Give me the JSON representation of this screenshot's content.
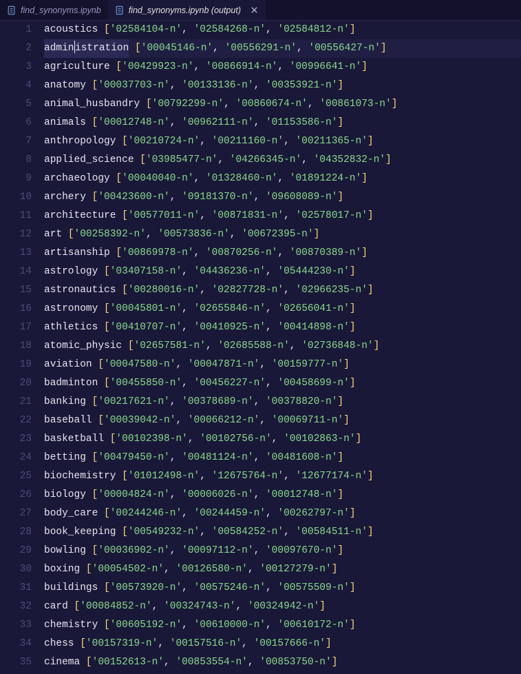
{
  "tabs": [
    {
      "label": "find_synonyms.ipynb",
      "active": false,
      "closable": false
    },
    {
      "label": "find_synonyms.ipynb (output)",
      "active": true,
      "closable": true
    }
  ],
  "lines": [
    {
      "n": 1,
      "word": "acoustics",
      "ids": [
        "02584104-n",
        "02584268-n",
        "02584812-n"
      ]
    },
    {
      "n": 2,
      "word": "administration",
      "ids": [
        "00045146-n",
        "00556291-n",
        "00556427-n"
      ],
      "selected": true,
      "cursor": 5
    },
    {
      "n": 3,
      "word": "agriculture",
      "ids": [
        "00429923-n",
        "00866914-n",
        "00996641-n"
      ]
    },
    {
      "n": 4,
      "word": "anatomy",
      "ids": [
        "00037703-n",
        "00133136-n",
        "00353921-n"
      ]
    },
    {
      "n": 5,
      "word": "animal_husbandry",
      "ids": [
        "00792299-n",
        "00860674-n",
        "00861073-n"
      ]
    },
    {
      "n": 6,
      "word": "animals",
      "ids": [
        "00012748-n",
        "00962111-n",
        "01153586-n"
      ]
    },
    {
      "n": 7,
      "word": "anthropology",
      "ids": [
        "00210724-n",
        "00211160-n",
        "00211365-n"
      ]
    },
    {
      "n": 8,
      "word": "applied_science",
      "ids": [
        "03985477-n",
        "04266345-n",
        "04352832-n"
      ]
    },
    {
      "n": 9,
      "word": "archaeology",
      "ids": [
        "00040040-n",
        "01328460-n",
        "01891224-n"
      ]
    },
    {
      "n": 10,
      "word": "archery",
      "ids": [
        "00423600-n",
        "09181370-n",
        "09608089-n"
      ]
    },
    {
      "n": 11,
      "word": "architecture",
      "ids": [
        "00577011-n",
        "00871831-n",
        "02578017-n"
      ]
    },
    {
      "n": 12,
      "word": "art",
      "ids": [
        "00258392-n",
        "00573836-n",
        "00672395-n"
      ]
    },
    {
      "n": 13,
      "word": "artisanship",
      "ids": [
        "00869978-n",
        "00870256-n",
        "00870389-n"
      ]
    },
    {
      "n": 14,
      "word": "astrology",
      "ids": [
        "03407158-n",
        "04436236-n",
        "05444230-n"
      ]
    },
    {
      "n": 15,
      "word": "astronautics",
      "ids": [
        "00280016-n",
        "02827728-n",
        "02966235-n"
      ]
    },
    {
      "n": 16,
      "word": "astronomy",
      "ids": [
        "00045801-n",
        "02655846-n",
        "02656041-n"
      ]
    },
    {
      "n": 17,
      "word": "athletics",
      "ids": [
        "00410707-n",
        "00410925-n",
        "00414898-n"
      ]
    },
    {
      "n": 18,
      "word": "atomic_physic",
      "ids": [
        "02657581-n",
        "02685588-n",
        "02736848-n"
      ]
    },
    {
      "n": 19,
      "word": "aviation",
      "ids": [
        "00047580-n",
        "00047871-n",
        "00159777-n"
      ]
    },
    {
      "n": 20,
      "word": "badminton",
      "ids": [
        "00455850-n",
        "00456227-n",
        "00458699-n"
      ]
    },
    {
      "n": 21,
      "word": "banking",
      "ids": [
        "00217621-n",
        "00378689-n",
        "00378820-n"
      ]
    },
    {
      "n": 22,
      "word": "baseball",
      "ids": [
        "00039042-n",
        "00066212-n",
        "00069711-n"
      ]
    },
    {
      "n": 23,
      "word": "basketball",
      "ids": [
        "00102398-n",
        "00102756-n",
        "00102863-n"
      ]
    },
    {
      "n": 24,
      "word": "betting",
      "ids": [
        "00479450-n",
        "00481124-n",
        "00481608-n"
      ]
    },
    {
      "n": 25,
      "word": "biochemistry",
      "ids": [
        "01012498-n",
        "12675764-n",
        "12677174-n"
      ]
    },
    {
      "n": 26,
      "word": "biology",
      "ids": [
        "00004824-n",
        "00006026-n",
        "00012748-n"
      ]
    },
    {
      "n": 27,
      "word": "body_care",
      "ids": [
        "00244246-n",
        "00244459-n",
        "00262797-n"
      ]
    },
    {
      "n": 28,
      "word": "book_keeping",
      "ids": [
        "00549232-n",
        "00584252-n",
        "00584511-n"
      ]
    },
    {
      "n": 29,
      "word": "bowling",
      "ids": [
        "00036902-n",
        "00097112-n",
        "00097670-n"
      ]
    },
    {
      "n": 30,
      "word": "boxing",
      "ids": [
        "00054502-n",
        "00126580-n",
        "00127279-n"
      ]
    },
    {
      "n": 31,
      "word": "buildings",
      "ids": [
        "00573920-n",
        "00575246-n",
        "00575509-n"
      ]
    },
    {
      "n": 32,
      "word": "card",
      "ids": [
        "00084852-n",
        "00324743-n",
        "00324942-n"
      ]
    },
    {
      "n": 33,
      "word": "chemistry",
      "ids": [
        "00605192-n",
        "00610000-n",
        "00610172-n"
      ]
    },
    {
      "n": 34,
      "word": "chess",
      "ids": [
        "00157319-n",
        "00157516-n",
        "00157666-n"
      ]
    },
    {
      "n": 35,
      "word": "cinema",
      "ids": [
        "00152613-n",
        "00853554-n",
        "00853750-n"
      ]
    }
  ]
}
